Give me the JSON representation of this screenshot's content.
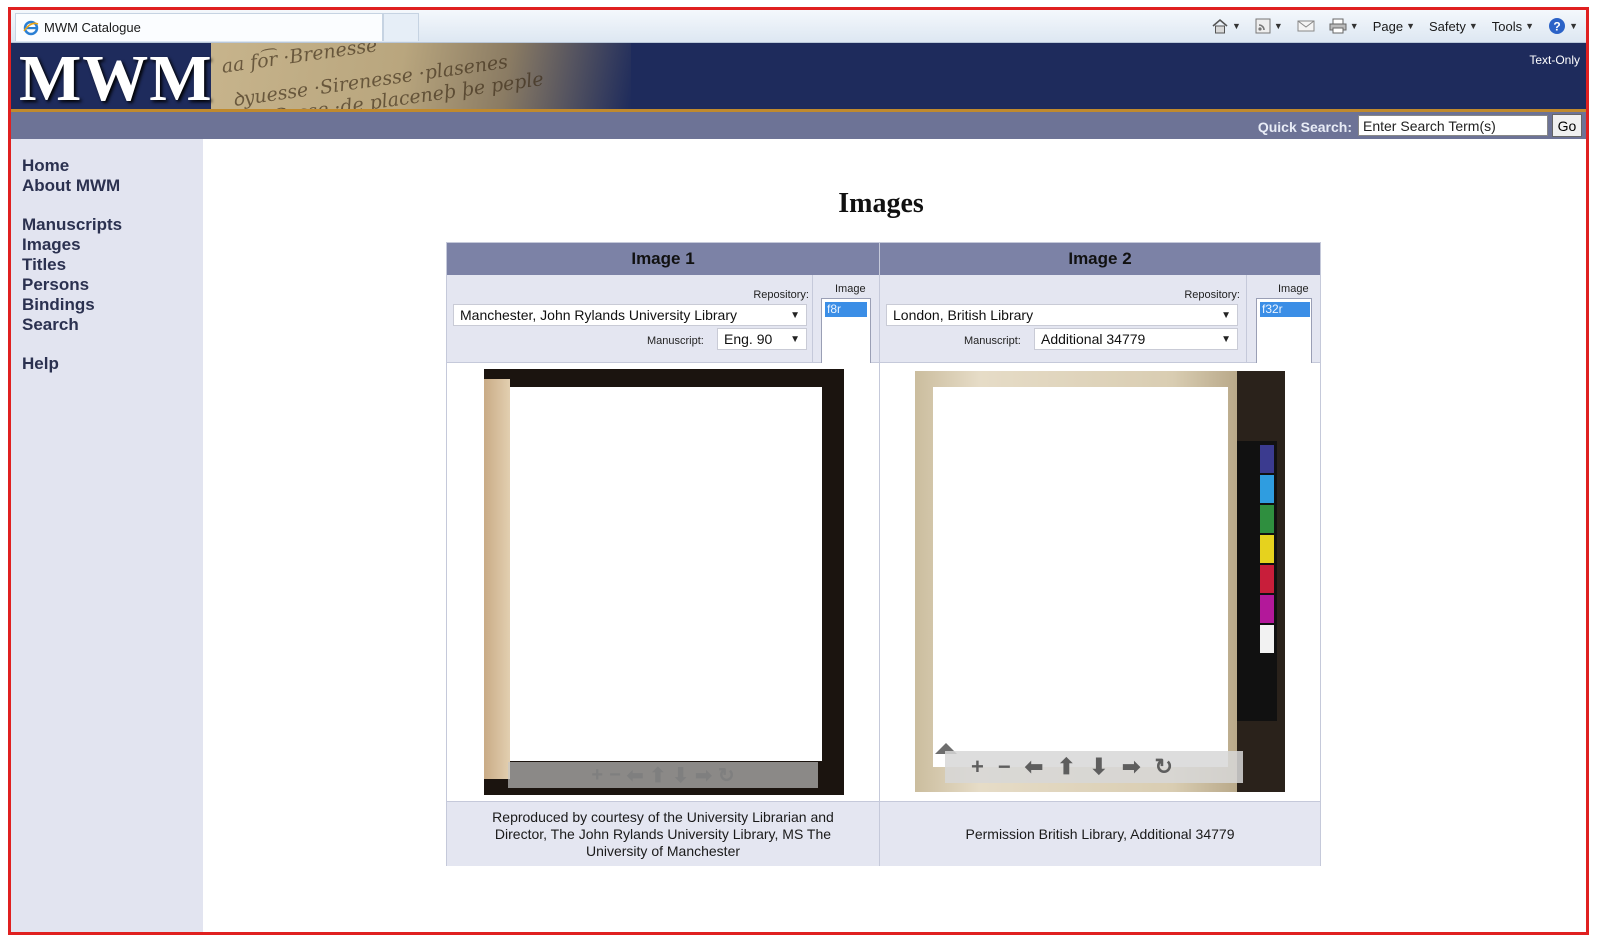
{
  "browser": {
    "tab_title": "MWM Catalogue",
    "commands": {
      "page": "Page",
      "safety": "Safety",
      "tools": "Tools"
    }
  },
  "site": {
    "logo": "MWM",
    "text_only": "Text-Only",
    "quick_search": {
      "label": "Quick Search:",
      "value": "Enter Search Term(s)",
      "button": "Go"
    }
  },
  "sidebar": {
    "group1": [
      "Home",
      "About MWM"
    ],
    "group2": [
      "Manuscripts",
      "Images",
      "Titles",
      "Persons",
      "Bindings",
      "Search"
    ],
    "group3": [
      "Help"
    ]
  },
  "page": {
    "title": "Images"
  },
  "viewers": [
    {
      "heading": "Image 1",
      "repository_label": "Repository:",
      "repository": "Manchester, John Rylands University Library",
      "manuscript_label": "Manuscript:",
      "manuscript": "Eng. 90",
      "image_label": "Image",
      "image_selected": "f8r",
      "caption": "Reproduced by courtesy of the University Librarian and Director, The John Rylands University Library, MS The University of Manchester"
    },
    {
      "heading": "Image 2",
      "repository_label": "Repository:",
      "repository": "London, British Library",
      "manuscript_label": "Manuscript:",
      "manuscript": "Additional 34779",
      "image_label": "Image",
      "image_selected": "f32r",
      "caption": "Permission British Library, Additional 34779"
    }
  ],
  "viewer_controls": {
    "zoom_in": "+",
    "zoom_out": "−",
    "left": "⬅",
    "up": "⬆",
    "down": "⬇",
    "right": "➡",
    "reset": "↻"
  },
  "colors": {
    "frame_border": "#e02020",
    "banner": "#1e2b5c",
    "search_bar": "#6d7396",
    "sidebar": "#e2e4f0",
    "column_header": "#7c82a6",
    "selected_option": "#3b8ee6"
  }
}
